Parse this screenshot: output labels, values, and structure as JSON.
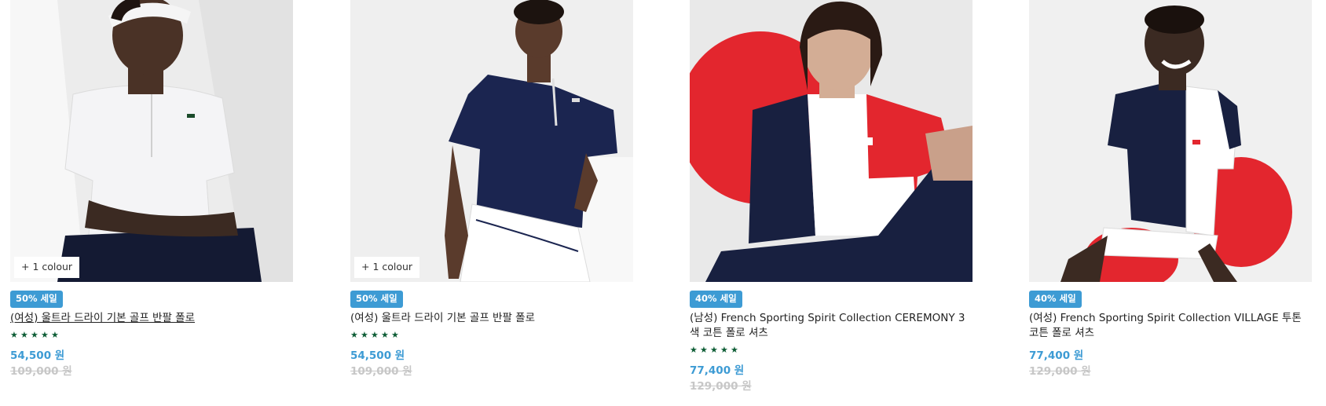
{
  "products": [
    {
      "colour_tag": "+ 1 colour",
      "badge": "50% 세일",
      "title": "(여성) 울트라 드라이 기본 골프 반팔 폴로",
      "rating_stars": 5,
      "price": "54,500 원",
      "old_price": "109,000 원",
      "shirt_color": "#f4f4f6",
      "pants_color": "#141a33"
    },
    {
      "colour_tag": "+ 1 colour",
      "badge": "50% 세일",
      "title": "(여성) 울트라 드라이 기본 골프 반팔 폴로",
      "rating_stars": 5,
      "price": "54,500 원",
      "old_price": "109,000 원",
      "shirt_color": "#1b2550",
      "pants_color": "#ffffff"
    },
    {
      "colour_tag": "",
      "badge": "40% 세일",
      "title": "(남성) French Sporting Spirit Collection CEREMONY 3색 코튼 폴로 셔츠",
      "rating_stars": 5,
      "price": "77,400 원",
      "old_price": "129,000 원",
      "shirt_color": "#ffffff",
      "pants_color": "#182040"
    },
    {
      "colour_tag": "",
      "badge": "40% 세일",
      "title": "(여성) French Sporting Spirit Collection VILLAGE 투톤 코튼 폴로 셔츠",
      "rating_stars": 0,
      "price": "77,400 원",
      "old_price": "129,000 원",
      "shirt_color": "#182040",
      "pants_color": "#ffffff"
    }
  ],
  "colors": {
    "badge_bg": "#3d9bd4",
    "price": "#3d9bd4",
    "old_price": "#c7c7c7",
    "star": "#0d5d35",
    "accent_red": "#e3262e"
  }
}
